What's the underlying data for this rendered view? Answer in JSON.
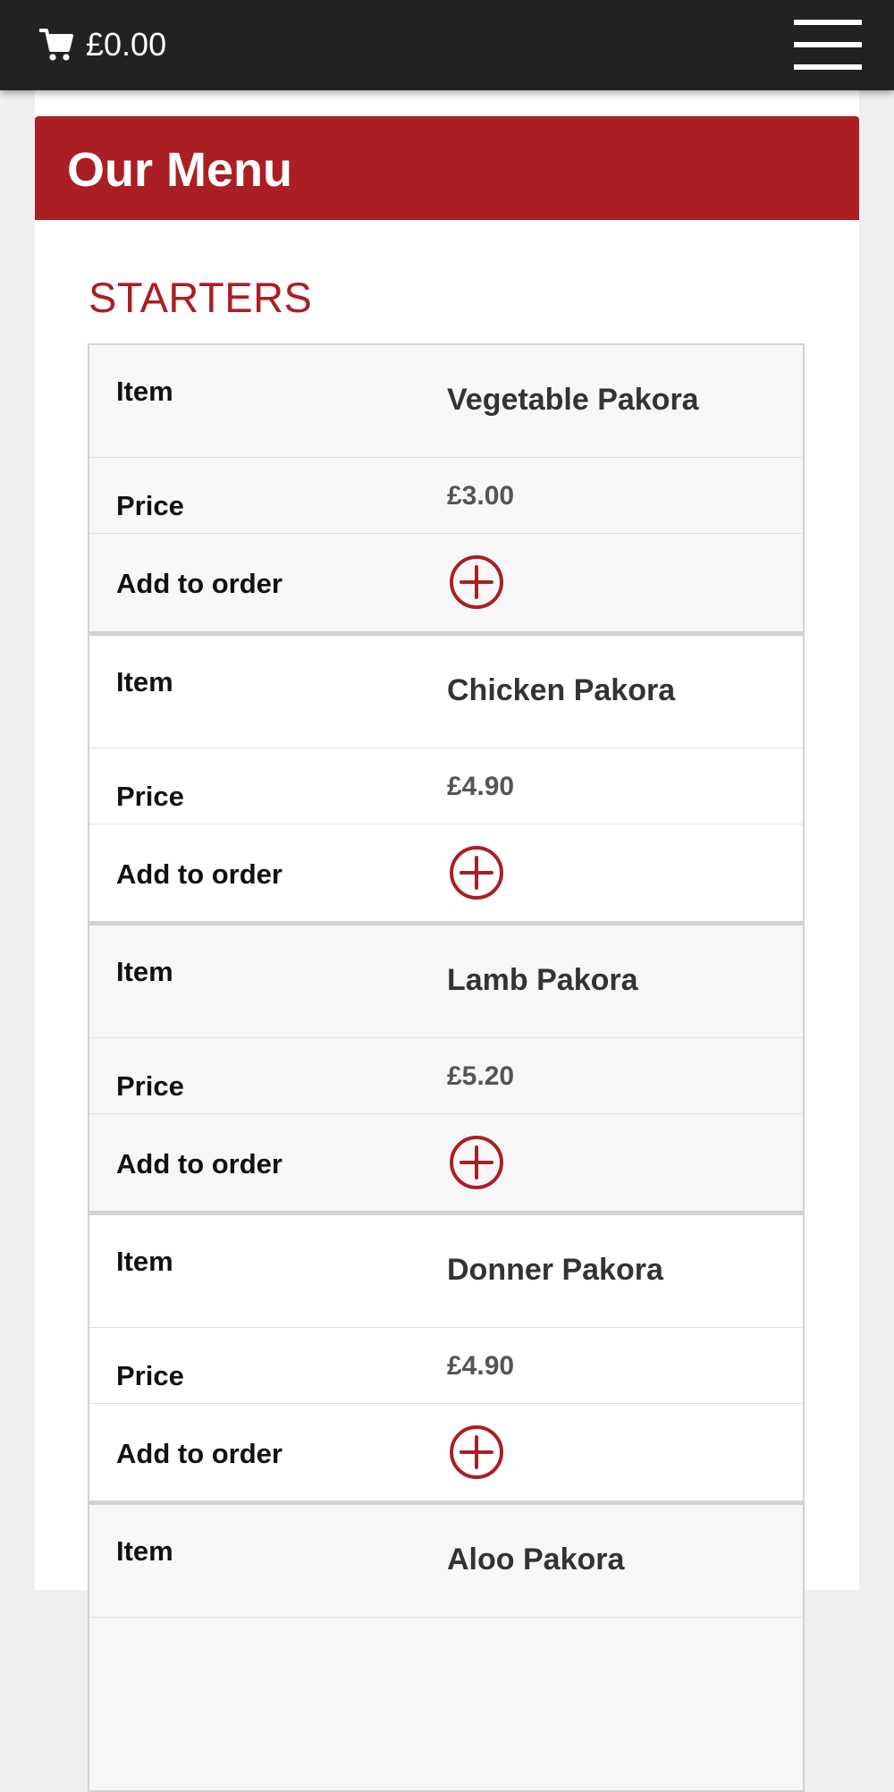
{
  "header": {
    "cart_total": "£0.00",
    "cart_icon": "shopping-cart-icon",
    "menu_icon": "hamburger-menu-icon"
  },
  "page": {
    "title": "Our Menu"
  },
  "section": {
    "title": "STARTERS",
    "labels": {
      "item": "Item",
      "price": "Price",
      "add": "Add to order"
    },
    "add_icon": "plus-circle-icon",
    "items": [
      {
        "name": "Vegetable Pakora",
        "price": "£3.00"
      },
      {
        "name": "Chicken Pakora",
        "price": "£4.90"
      },
      {
        "name": "Lamb Pakora",
        "price": "£5.20"
      },
      {
        "name": "Donner Pakora",
        "price": "£4.90"
      },
      {
        "name": "Aloo Pakora",
        "price": ""
      }
    ]
  },
  "colors": {
    "brand_red": "#ab1e23",
    "topbar": "#222222"
  }
}
